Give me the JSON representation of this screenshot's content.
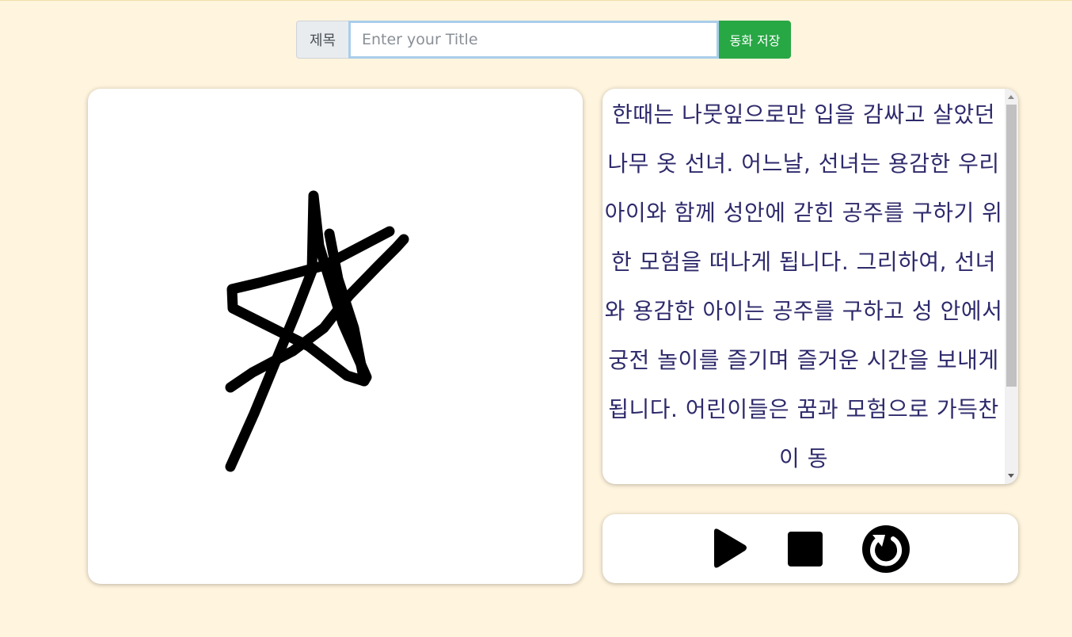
{
  "header": {
    "title_label": "제목",
    "title_placeholder": "Enter your Title",
    "title_value": "",
    "save_label": "동화 저장"
  },
  "story": {
    "text": "한때는 나뭇잎으로만 입을 감싸고 살았던 나무 옷 선녀. 어느날, 선녀는 용감한 우리 아이와 함께 성안에 갇힌 공주를 구하기 위한 모험을 떠나게 됩니다. 그리하여, 선녀와 용감한 아이는 공주를 구하고 성 안에서 궁전 놀이를 즐기며 즐거운 시간을 보내게 됩니다. 어린이들은 꿈과 모험으로 가득찬 이 동"
  },
  "controls": {
    "play_icon": "play-icon",
    "stop_icon": "stop-icon",
    "replay_icon": "replay-icon"
  },
  "colors": {
    "background": "#fff4dd",
    "save_button": "#28a745",
    "story_text": "#2e2a6b",
    "drawing_stroke": "#000000"
  }
}
